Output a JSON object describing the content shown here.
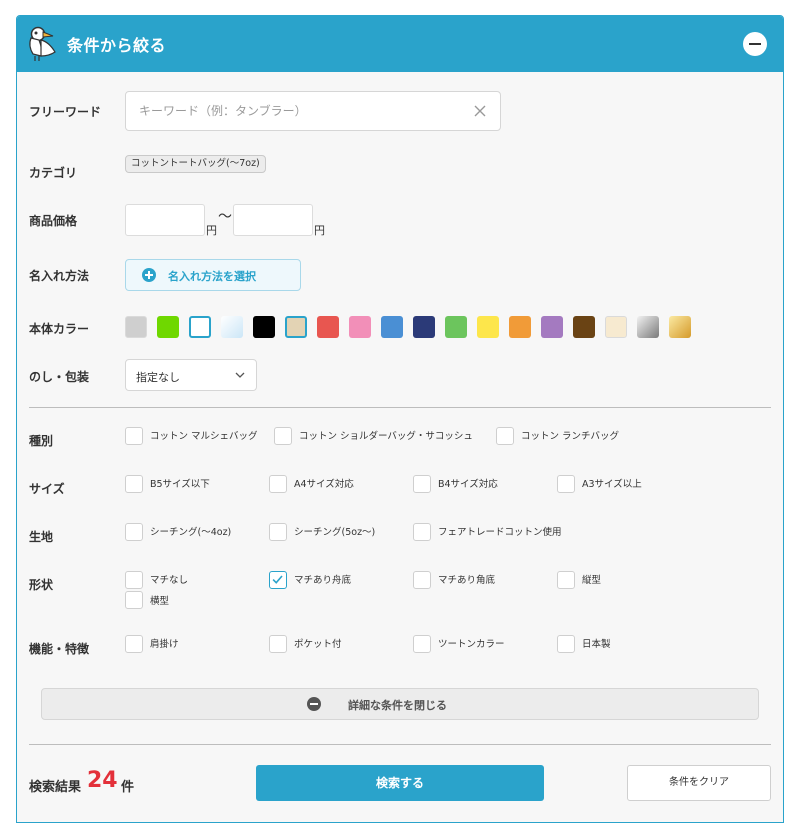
{
  "header": {
    "title": "条件から絞る",
    "logo_icon": "pelican-logo-icon",
    "collapse_icon": "minus-circle-icon",
    "accent_color": "#2aa3cb"
  },
  "freeword": {
    "label": "フリーワード",
    "placeholder": "キーワード（例：タンブラー）",
    "value": "",
    "clear_icon": "close-icon"
  },
  "category": {
    "label": "カテゴリ",
    "selected": "コットントートバッグ(〜7oz)"
  },
  "price": {
    "label": "商品価格",
    "min": "",
    "max": "",
    "separator": "〜",
    "unit": "円"
  },
  "naming": {
    "label": "名入れ方法",
    "button_label": "名入れ方法を選択",
    "icon": "plus-circle-icon"
  },
  "body_color": {
    "label": "本体カラー",
    "swatches": [
      {
        "name": "gray",
        "color": "#cfcfcf",
        "selected": false
      },
      {
        "name": "lime-green",
        "color": "#6fd800",
        "selected": false
      },
      {
        "name": "white",
        "color": "#ffffff",
        "selected": true
      },
      {
        "name": "clear",
        "color": "#d6ecf9",
        "selected": false
      },
      {
        "name": "black",
        "color": "#000000",
        "selected": false
      },
      {
        "name": "natural",
        "color": "#e3d3b4",
        "selected": true
      },
      {
        "name": "red",
        "color": "#e85650",
        "selected": false
      },
      {
        "name": "pink",
        "color": "#f28fb8",
        "selected": false
      },
      {
        "name": "blue",
        "color": "#4a8fd4",
        "selected": false
      },
      {
        "name": "navy",
        "color": "#2b3a78",
        "selected": false
      },
      {
        "name": "green",
        "color": "#6cc55d",
        "selected": false
      },
      {
        "name": "yellow",
        "color": "#fde64b",
        "selected": false
      },
      {
        "name": "orange",
        "color": "#f19b38",
        "selected": false
      },
      {
        "name": "purple",
        "color": "#a47ac0",
        "selected": false
      },
      {
        "name": "brown",
        "color": "#6a4314",
        "selected": false
      },
      {
        "name": "beige",
        "color": "#f7ead0",
        "selected": false
      },
      {
        "name": "silver",
        "color": "#b3b3b3",
        "selected": false
      },
      {
        "name": "gold",
        "color": "#dfb045",
        "selected": false
      }
    ]
  },
  "noshi": {
    "label": "のし・包装",
    "value": "指定なし",
    "icon": "chevron-down-icon"
  },
  "type": {
    "label": "種別",
    "options": [
      {
        "label": "コットン マルシェバッグ",
        "checked": false
      },
      {
        "label": "コットン ショルダーバッグ・サコッシュ",
        "checked": false
      },
      {
        "label": "コットン ランチバッグ",
        "checked": false
      }
    ]
  },
  "size": {
    "label": "サイズ",
    "options": [
      {
        "label": "B5サイズ以下",
        "checked": false
      },
      {
        "label": "A4サイズ対応",
        "checked": false
      },
      {
        "label": "B4サイズ対応",
        "checked": false
      },
      {
        "label": "A3サイズ以上",
        "checked": false
      }
    ]
  },
  "fabric": {
    "label": "生地",
    "options": [
      {
        "label": "シーチング(〜4oz)",
        "checked": false
      },
      {
        "label": "シーチング(5oz〜)",
        "checked": false
      },
      {
        "label": "フェアトレードコットン使用",
        "checked": false
      }
    ]
  },
  "shape": {
    "label": "形状",
    "options": [
      {
        "label": "マチなし",
        "checked": false
      },
      {
        "label": "マチあり舟底",
        "checked": true
      },
      {
        "label": "マチあり角底",
        "checked": false
      },
      {
        "label": "縦型",
        "checked": false
      },
      {
        "label": "横型",
        "checked": false
      }
    ]
  },
  "feature": {
    "label": "機能・特徴",
    "options": [
      {
        "label": "肩掛け",
        "checked": false
      },
      {
        "label": "ポケット付",
        "checked": false
      },
      {
        "label": "ツートンカラー",
        "checked": false
      },
      {
        "label": "日本製",
        "checked": false
      }
    ]
  },
  "close_detail": {
    "label": "詳細な条件を閉じる",
    "icon": "minus-circle-icon"
  },
  "result": {
    "prefix": "検索結果",
    "count": "24",
    "suffix": "件",
    "count_color": "#e3303a"
  },
  "actions": {
    "search_label": "検索する",
    "clear_label": "条件をクリア"
  }
}
